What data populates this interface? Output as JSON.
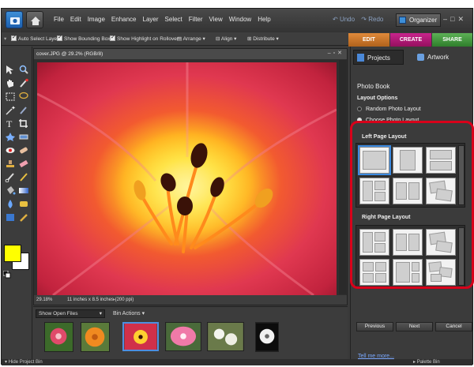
{
  "menubar": {
    "items": [
      "File",
      "Edit",
      "Image",
      "Enhance",
      "Layer",
      "Select",
      "Filter",
      "View",
      "Window",
      "Help"
    ],
    "undo": "Undo",
    "redo": "Redo",
    "organizer": "Organizer"
  },
  "options": {
    "auto_select": "Auto Select Layer",
    "bounding_box": "Show Bounding Box",
    "highlight": "Show Highlight on Rollover",
    "arrange": "Arrange",
    "align": "Align",
    "distribute": "Distribute"
  },
  "modes": {
    "edit": "EDIT",
    "create": "CREATE",
    "share": "SHARE"
  },
  "document": {
    "title": "cover.JPG @ 29.2% (RGB/8)",
    "zoom": "29.18%",
    "size": "11 inches x 8.5 inches (200 ppi)"
  },
  "bin": {
    "dropdown": "Show Open Files",
    "actions": "Bin Actions"
  },
  "panel": {
    "tab_projects": "Projects",
    "tab_artwork": "Artwork",
    "heading": "Photo Book",
    "layout_options": "Layout Options",
    "option_random": "Random Photo Layout",
    "option_choose": "Choose Photo Layout",
    "left_layout": "Left Page Layout",
    "right_layout": "Right Page Layout",
    "previous": "Previous",
    "next": "Next",
    "cancel": "Cancel",
    "tell_me_more": "Tell me more..."
  },
  "statusbar": {
    "hide_bin": "Hide Project Bin",
    "palette_bin": "Palette Bin"
  },
  "colors": {
    "foreground": "#ffff00",
    "background": "#ffffff",
    "edit_tab": "#c8762a",
    "create_tab": "#b0197a",
    "share_tab": "#3e9a3a",
    "highlight_ring": "#d8001a"
  }
}
